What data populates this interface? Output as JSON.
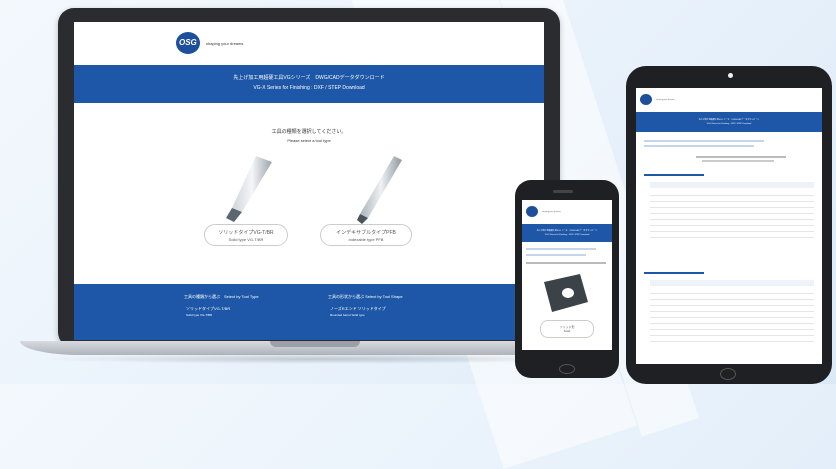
{
  "site": {
    "tagline": "shaping your dreams",
    "logo_text": "OSG",
    "header_jp": "先上げ加工用超硬工具VGシリーズ　DWG/CADデータダウンロード",
    "header_en": "VG-X Series for Finishing : DXF / STEP Download"
  },
  "laptop": {
    "select_jp": "工具の種類を選択してください。",
    "select_en": "Please select a tool type",
    "tools": [
      {
        "jp": "ソリッドタイプVG-T/BR",
        "en": "Solid type VG-T/BR"
      },
      {
        "jp": "インデキサブルタイプPFB",
        "en": "Indexable type PFB"
      }
    ],
    "footer": {
      "col1_title": "工具の種類から選ぶ　Select by Tool Type",
      "col1_item_jp": "ソリッドタイプVG-T/BR",
      "col1_item_en": "Solid type VG-T/BR",
      "col2_title": "工具の形状から選ぶ Select by Tool Shape",
      "col2_item_jp": "ノーズRエンド ソリッドタイプ",
      "col2_item_en": "Rounded barrel Solid type"
    }
  },
  "phone": {
    "card_label_jp": "ソリッド形",
    "card_label_en": "Solid"
  },
  "colors": {
    "brand": "#1e57a8",
    "dark": "#1d4f9c"
  }
}
